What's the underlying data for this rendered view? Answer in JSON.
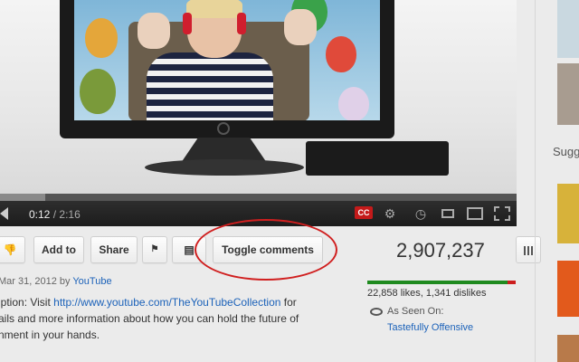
{
  "player": {
    "time_current": "0:12",
    "time_separator": "/",
    "time_duration": "2:16",
    "progress": 0.088,
    "cc_label": "CC"
  },
  "actions": {
    "add_to_label": "Add to",
    "share_label": "Share",
    "toggle_comments_label": "Toggle comments"
  },
  "stats": {
    "views": "2,907,237",
    "likes_text": "22,858 likes, 1,341 dislikes",
    "like_ratio": 0.945,
    "as_seen_on_label": "As Seen On:",
    "as_seen_on_link": "Tastefully Offensive"
  },
  "meta": {
    "date_prefix": "Mar 31, 2012 by ",
    "uploader": "YouTube"
  },
  "description": {
    "prefix": "iption: Visit ",
    "link": "http://www.youtube.com/TheYouTubeCollection",
    "suffix": " for",
    "line2": "ails and more information about how you can hold the future of",
    "line3": "nment in your hands."
  },
  "sidebar": {
    "suggestions_label": "Sugg"
  },
  "colors": {
    "link": "#1c62b9",
    "annotation_circle": "#d01f1f",
    "like_bar": "#1f8a1f",
    "dislike_bar": "#cc1e1e",
    "cc_badge": "#c41a1a"
  }
}
